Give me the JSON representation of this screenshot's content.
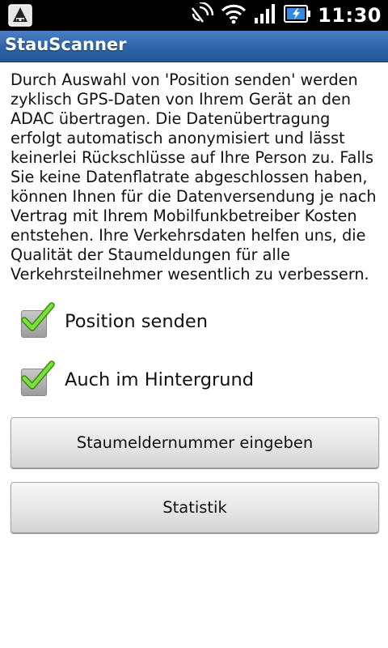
{
  "statusbar": {
    "time": "11:30",
    "icons": [
      "notification-app-icon",
      "nfc-icon",
      "wifi-icon",
      "signal-icon",
      "battery-charging-icon"
    ]
  },
  "titlebar": {
    "title": "StauScanner"
  },
  "description": "Durch Auswahl von 'Position senden' werden zyklisch GPS-Daten von Ihrem Gerät an den ADAC übertragen. Die Datenübertragung erfolgt automatisch anonymisiert und lässt keinerlei Rückschlüsse auf Ihre Person zu. Falls Sie keine Datenflatrate abgeschlossen haben, können Ihnen für die Datenversendung je nach Vertrag mit Ihrem Mobilfunkbetreiber Kosten entstehen. Ihre Verkehrsdaten helfen uns, die Qualität der Staumeldungen für alle Verkehrsteilnehmer wesentlich zu verbessern.",
  "checkboxes": [
    {
      "label": "Position senden",
      "checked": true
    },
    {
      "label": "Auch im Hintergrund",
      "checked": true
    }
  ],
  "buttons": {
    "staumelder": "Staumeldernummer eingeben",
    "statistik": "Statistik"
  },
  "colors": {
    "accent": "#2f63a9",
    "check": "#6fd12a"
  }
}
